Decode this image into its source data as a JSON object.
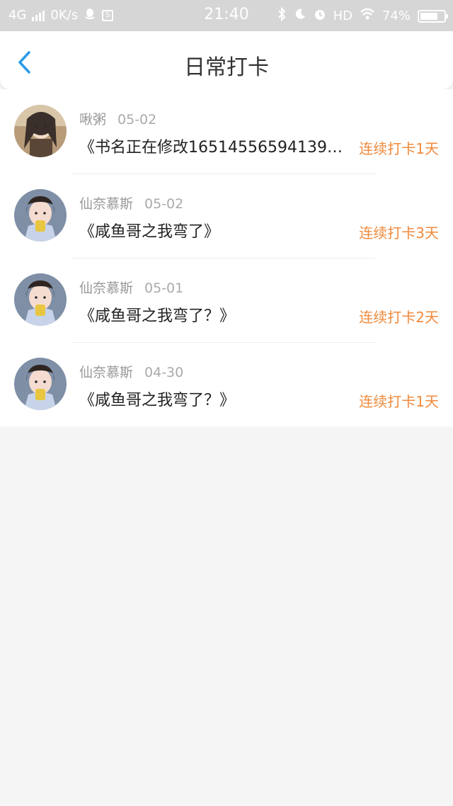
{
  "status_bar": {
    "network": "4G",
    "speed": "0K/s",
    "time": "21:40",
    "hd": "HD",
    "battery": "74%",
    "battery_level": 0.74,
    "icons": [
      "signal-icon",
      "qq-icon",
      "sim-icon",
      "bluetooth-icon",
      "moon-icon",
      "alarm-icon",
      "wifi-icon",
      "battery-icon"
    ]
  },
  "header": {
    "title": "日常打卡",
    "back_icon": "chevron-left-icon",
    "accent": "#2a9ae8"
  },
  "colors": {
    "streak": "#f08a3c",
    "background": "#f5f5f5"
  },
  "checkins": [
    {
      "user": "啾粥",
      "date": "05-02",
      "book": "《书名正在修改16514556594139…",
      "streak": "连续打卡1天",
      "avatar_icon": "avatar-anime"
    },
    {
      "user": "仙奈慕斯",
      "date": "05-02",
      "book": "《咸鱼哥之我弯了》",
      "streak": "连续打卡3天",
      "avatar_icon": "avatar-girl"
    },
    {
      "user": "仙奈慕斯",
      "date": "05-01",
      "book": "《咸鱼哥之我弯了？》",
      "streak": "连续打卡2天",
      "avatar_icon": "avatar-girl"
    },
    {
      "user": "仙奈慕斯",
      "date": "04-30",
      "book": "《咸鱼哥之我弯了？》",
      "streak": "连续打卡1天",
      "avatar_icon": "avatar-girl"
    }
  ]
}
